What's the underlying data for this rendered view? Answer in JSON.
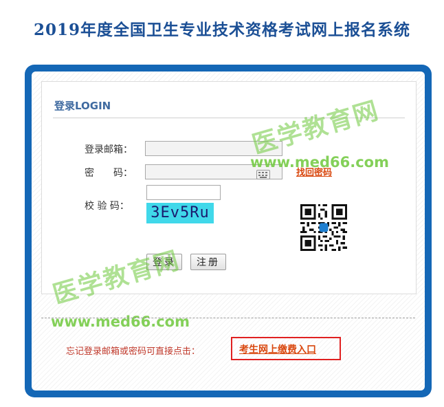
{
  "page": {
    "title": "2019年度全国卫生专业技术资格考试网上报名系统"
  },
  "login": {
    "heading": "登录LOGIN",
    "email_label": "登录邮箱：",
    "email_value": "",
    "password_label": "密　　码：",
    "password_value": "",
    "forgot_password_link": "找回密码",
    "captcha_label": "校 验 码：",
    "captcha_value": "",
    "captcha_text": "3Ev5Ru",
    "login_button": "登录",
    "register_button": "注册"
  },
  "watermarks": {
    "cn_text": "医学教育网",
    "url_text": "www.med66.com"
  },
  "footer": {
    "notice": "忘记登录邮箱或密码可直接点击：",
    "payment_link": "考生网上缴费入口"
  },
  "colors": {
    "frame": "#1467b6",
    "title": "#1b4f95",
    "link": "#d9480f",
    "notice": "#c0392b",
    "captcha_bg": "#40d8ea",
    "highlight_border": "#e02020"
  },
  "icons": {
    "keyboard": "keyboard-icon",
    "qr": "qr-code-icon"
  }
}
